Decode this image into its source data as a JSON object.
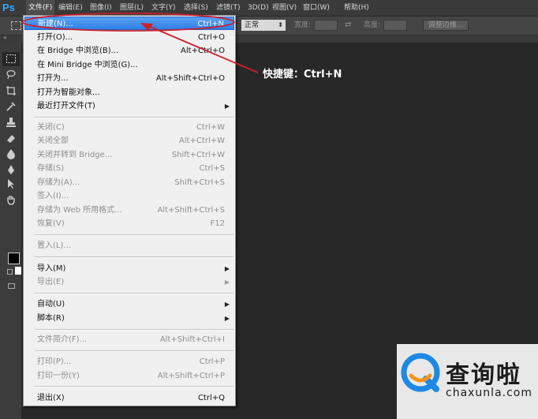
{
  "app": {
    "logo": "Ps",
    "brand_color": "#31a8ff",
    "highlight_color": "#3b8ff0",
    "annotation_color": "#cc1f2b"
  },
  "menubar": {
    "items": [
      {
        "label": "文件(F)",
        "active": true
      },
      {
        "label": "编辑(E)"
      },
      {
        "label": "图像(I)"
      },
      {
        "label": "图层(L)"
      },
      {
        "label": "文字(Y)"
      },
      {
        "label": "选择(S)"
      },
      {
        "label": "滤镜(T)"
      },
      {
        "label": "3D(D)"
      },
      {
        "label": "视图(V)"
      },
      {
        "label": "窗口(W)"
      },
      {
        "label": "帮助(H)"
      }
    ]
  },
  "options": {
    "style_value": "正常",
    "width_label": "宽度:",
    "height_label": "高度:",
    "swap_icon": "swap-arrows-icon",
    "refine_edge_label": "调整边缘..."
  },
  "file_menu": {
    "items": [
      {
        "label": "新建(N)...",
        "shortcut": "Ctrl+N",
        "enabled": true,
        "highlighted": true
      },
      {
        "label": "打开(O)...",
        "shortcut": "Ctrl+O",
        "enabled": true
      },
      {
        "label": "在 Bridge 中浏览(B)...",
        "shortcut": "Alt+Ctrl+O",
        "enabled": true
      },
      {
        "label": "在 Mini Bridge 中浏览(G)...",
        "shortcut": "",
        "enabled": true
      },
      {
        "label": "打开为...",
        "shortcut": "Alt+Shift+Ctrl+O",
        "enabled": true
      },
      {
        "label": "打开为智能对象...",
        "shortcut": "",
        "enabled": true
      },
      {
        "label": "最近打开文件(T)",
        "shortcut": "",
        "enabled": true,
        "submenu": true
      },
      {
        "label": "关闭(C)",
        "shortcut": "Ctrl+W",
        "enabled": false
      },
      {
        "label": "关闭全部",
        "shortcut": "Alt+Ctrl+W",
        "enabled": false
      },
      {
        "label": "关闭并转到 Bridge...",
        "shortcut": "Shift+Ctrl+W",
        "enabled": false
      },
      {
        "label": "存储(S)",
        "shortcut": "Ctrl+S",
        "enabled": false
      },
      {
        "label": "存储为(A)...",
        "shortcut": "Shift+Ctrl+S",
        "enabled": false
      },
      {
        "label": "签入(I)...",
        "shortcut": "",
        "enabled": false
      },
      {
        "label": "存储为 Web 所用格式...",
        "shortcut": "Alt+Shift+Ctrl+S",
        "enabled": false
      },
      {
        "label": "恢复(V)",
        "shortcut": "F12",
        "enabled": false
      },
      {
        "label": "置入(L)...",
        "shortcut": "",
        "enabled": false
      },
      {
        "label": "导入(M)",
        "shortcut": "",
        "enabled": true,
        "submenu": true
      },
      {
        "label": "导出(E)",
        "shortcut": "",
        "enabled": false,
        "submenu": true
      },
      {
        "label": "自动(U)",
        "shortcut": "",
        "enabled": true,
        "submenu": true
      },
      {
        "label": "脚本(R)",
        "shortcut": "",
        "enabled": true,
        "submenu": true
      },
      {
        "label": "文件简介(F)...",
        "shortcut": "Alt+Shift+Ctrl+I",
        "enabled": false
      },
      {
        "label": "打印(P)...",
        "shortcut": "Ctrl+P",
        "enabled": false
      },
      {
        "label": "打印一份(Y)",
        "shortcut": "Alt+Shift+Ctrl+P",
        "enabled": false
      },
      {
        "label": "退出(X)",
        "shortcut": "Ctrl+Q",
        "enabled": true
      }
    ]
  },
  "annotation": {
    "text": "快捷键：Ctrl+N"
  },
  "watermark": {
    "name": "查询啦",
    "url": "chaxunla.com",
    "logo_color": "#1e88e5",
    "logo_accent": "#f7941d"
  }
}
